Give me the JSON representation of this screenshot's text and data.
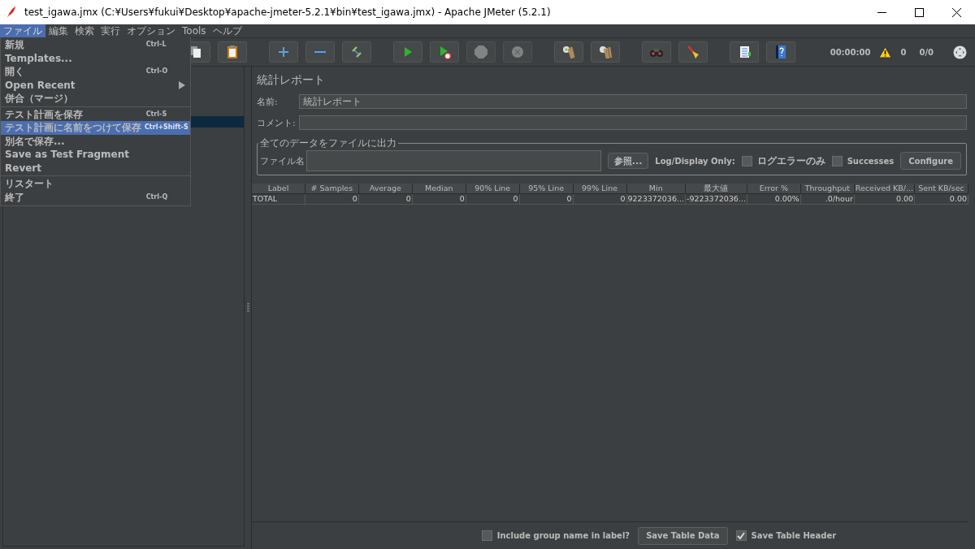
{
  "window": {
    "title": "test_igawa.jmx (C:¥Users¥fukui¥Desktop¥apache-jmeter-5.2.1¥bin¥test_igawa.jmx) - Apache JMeter (5.2.1)"
  },
  "menubar": [
    {
      "label": "ファイル",
      "selected": true
    },
    {
      "label": "編集",
      "selected": false
    },
    {
      "label": "検索",
      "selected": false
    },
    {
      "label": "実行",
      "selected": false
    },
    {
      "label": "オプション",
      "selected": false
    },
    {
      "label": "Tools",
      "selected": false
    },
    {
      "label": "ヘルプ",
      "selected": false
    }
  ],
  "file_menu": [
    {
      "kind": "item",
      "label": "新規",
      "shortcut": "Ctrl-L",
      "selected": false
    },
    {
      "kind": "item",
      "label": "Templates...",
      "selected": false
    },
    {
      "kind": "item",
      "label": "開く",
      "shortcut": "Ctrl-O",
      "selected": false
    },
    {
      "kind": "submenu",
      "label": "Open Recent",
      "selected": false
    },
    {
      "kind": "item",
      "label": "併合（マージ）",
      "selected": false
    },
    {
      "kind": "separator"
    },
    {
      "kind": "item",
      "label": "テスト計画を保存",
      "shortcut": "Ctrl-S",
      "selected": false
    },
    {
      "kind": "item",
      "label": "テスト計画に名前をつけて保存",
      "shortcut": "Ctrl+Shift-S",
      "selected": true
    },
    {
      "kind": "item",
      "label": "別名で保存...",
      "selected": false
    },
    {
      "kind": "item",
      "label": "Save as Test Fragment",
      "selected": false
    },
    {
      "kind": "item",
      "label": "Revert",
      "selected": false
    },
    {
      "kind": "separator"
    },
    {
      "kind": "item",
      "label": "リスタート",
      "selected": false
    },
    {
      "kind": "item",
      "label": "終了",
      "shortcut": "Ctrl-Q",
      "selected": false
    }
  ],
  "toolbar": [
    {
      "kind": "copy",
      "disabled": false
    },
    {
      "kind": "paste",
      "disabled": false
    },
    {
      "kind": "gap"
    },
    {
      "kind": "add",
      "disabled": false
    },
    {
      "kind": "remove",
      "disabled": false
    },
    {
      "kind": "toggle",
      "disabled": false
    },
    {
      "kind": "gap"
    },
    {
      "kind": "start",
      "disabled": false
    },
    {
      "kind": "start-no-timers",
      "disabled": false
    },
    {
      "kind": "stop",
      "disabled": true
    },
    {
      "kind": "shutdown",
      "disabled": true
    },
    {
      "kind": "gap"
    },
    {
      "kind": "clear",
      "disabled": false
    },
    {
      "kind": "clear-all",
      "disabled": false
    },
    {
      "kind": "gap"
    },
    {
      "kind": "search",
      "disabled": false
    },
    {
      "kind": "reset-search",
      "disabled": false
    },
    {
      "kind": "gap"
    },
    {
      "kind": "function-helper",
      "disabled": false
    },
    {
      "kind": "help",
      "disabled": false
    }
  ],
  "status": {
    "elapsed": "00:00:00",
    "warnings": "0",
    "threads": "0/0"
  },
  "report": {
    "title": "統計レポート",
    "name_label": "名前:",
    "name_value": "統計レポート",
    "comment_label": "コメント:",
    "file_group": {
      "legend": "全てのデータをファイルに出力",
      "file_label": "ファイル名",
      "browse": "参照...",
      "log_label": "Log/Display Only:",
      "options": [
        {
          "label": "ログエラーのみ",
          "checked": false
        },
        {
          "label": "Successes",
          "checked": false
        }
      ],
      "configure": "Configure"
    }
  },
  "table": {
    "columns": [
      "Label",
      "# Samples",
      "Average",
      "Median",
      "90% Line",
      "95% Line",
      "99% Line",
      "Min",
      "最大値",
      "Error %",
      "Throughput",
      "Received KB/...",
      "Sent KB/sec"
    ],
    "rows": [
      [
        "TOTAL",
        "0",
        "0",
        "0",
        "0",
        "0",
        "0",
        "9223372036...",
        "-9223372036...",
        "0.00%",
        ".0/hour",
        "0.00",
        "0.00"
      ]
    ]
  },
  "footer": {
    "include_group": {
      "label": "Include group name in label?",
      "checked": false
    },
    "save_data": "Save Table Data",
    "save_header": {
      "label": "Save Table Header",
      "checked": true
    }
  }
}
